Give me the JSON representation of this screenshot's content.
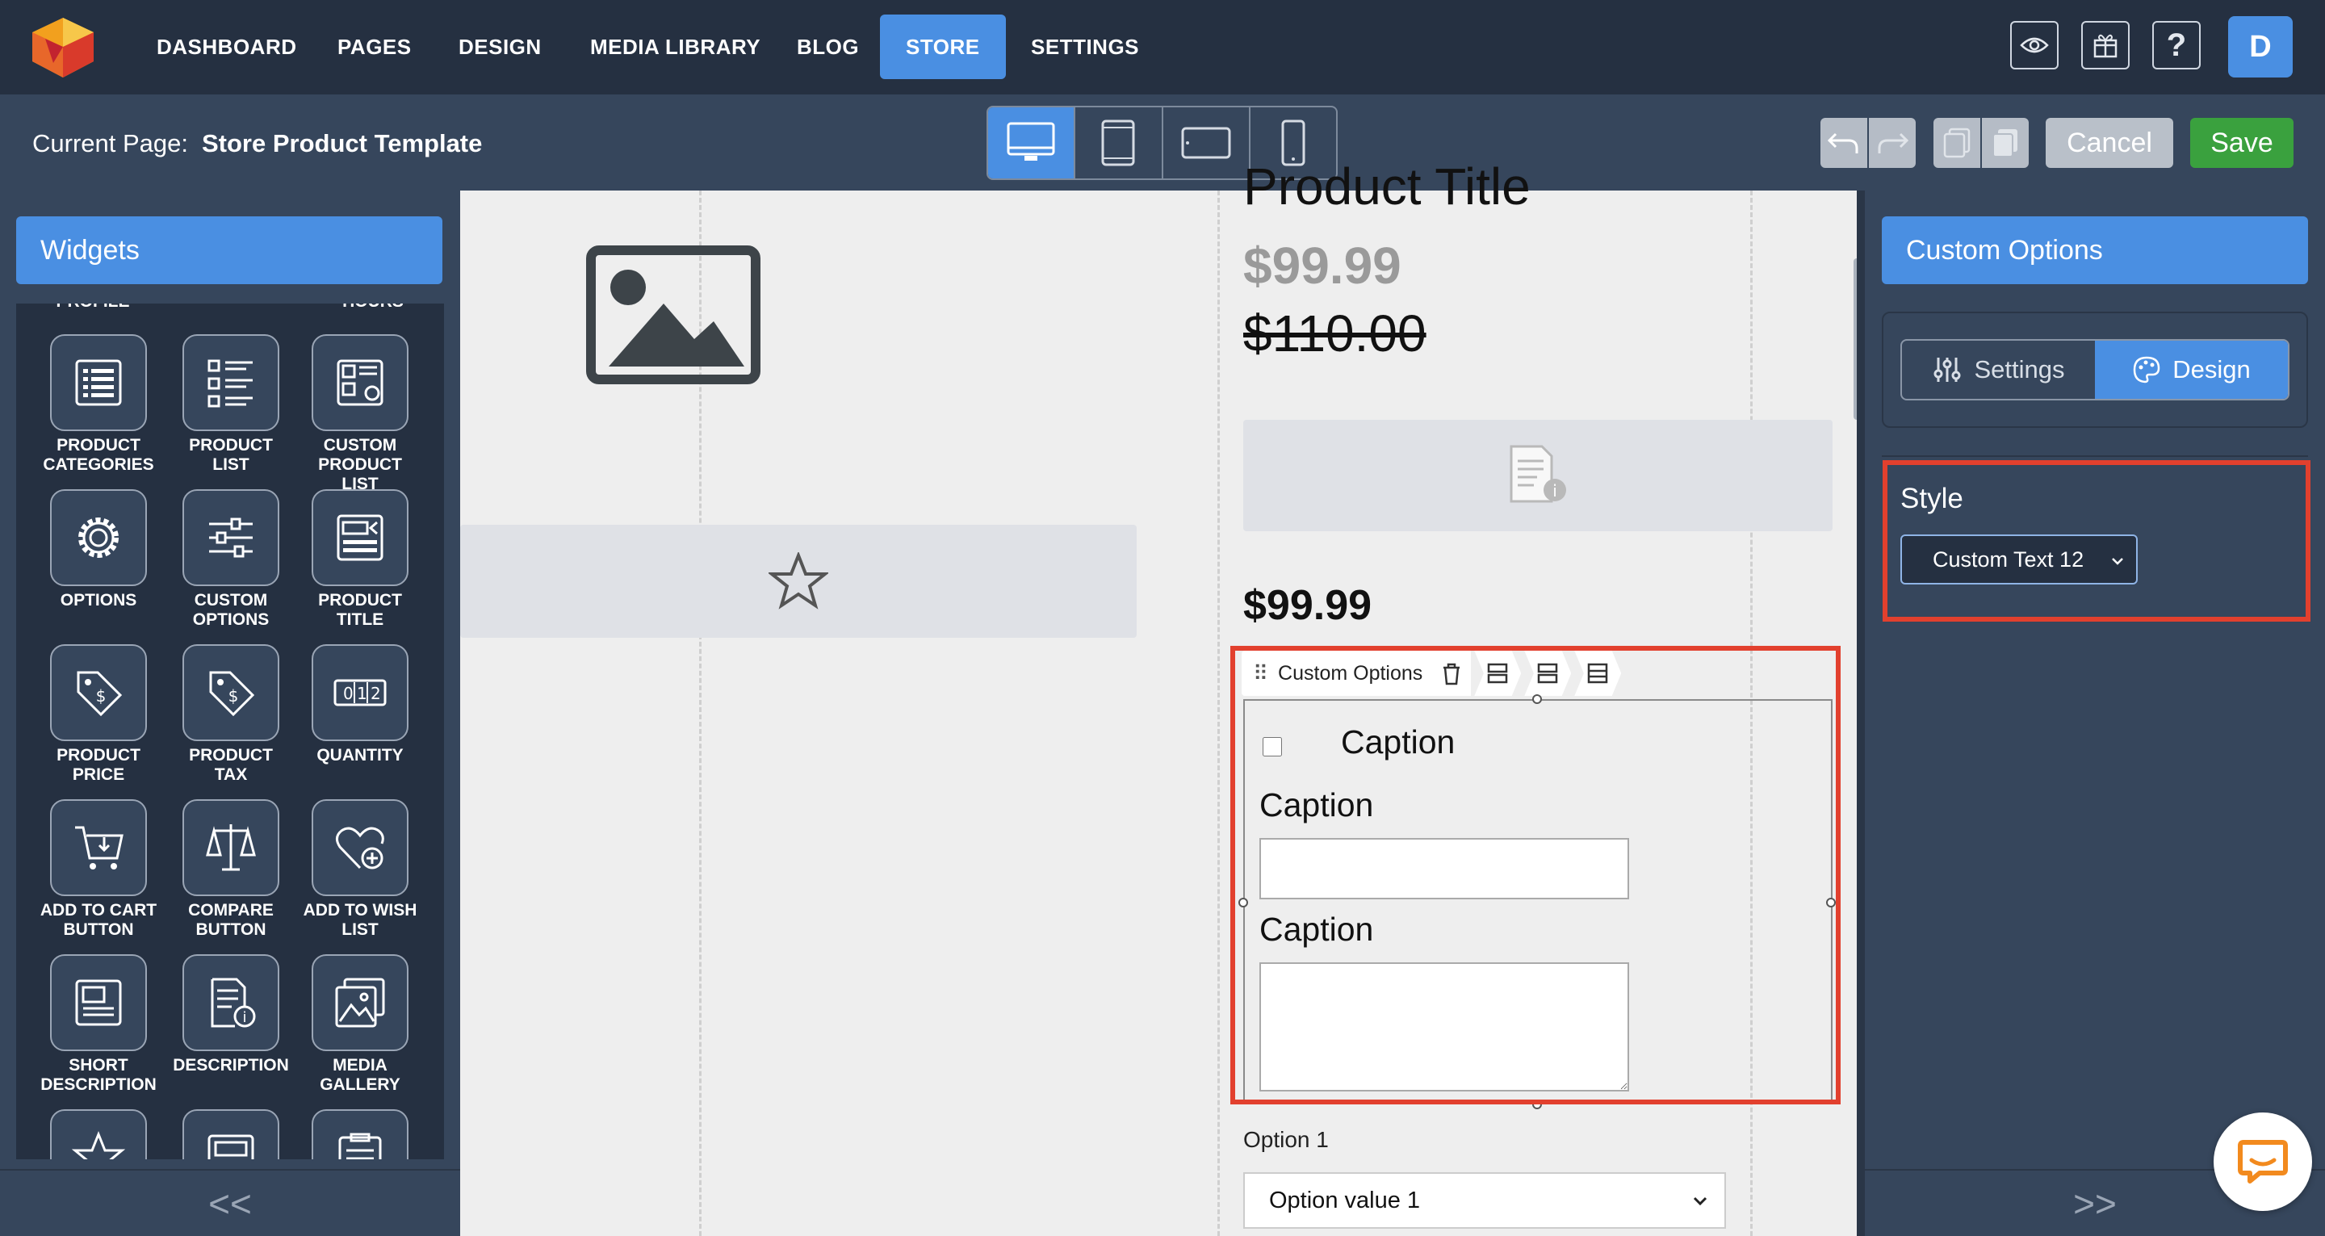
{
  "nav": {
    "items": [
      {
        "label": "DASHBOARD"
      },
      {
        "label": "PAGES"
      },
      {
        "label": "DESIGN"
      },
      {
        "label": "MEDIA LIBRARY"
      },
      {
        "label": "BLOG"
      },
      {
        "label": "STORE",
        "active": true
      },
      {
        "label": "SETTINGS"
      }
    ],
    "user_initial": "D",
    "icons": [
      "eye-icon",
      "add-gift-icon",
      "help-icon"
    ]
  },
  "subbar": {
    "current_page_label": "Current Page:",
    "current_page_name": "Store Product Template",
    "devices": [
      "desktop",
      "tablet-portrait",
      "tablet-landscape",
      "phone"
    ],
    "active_device": "desktop",
    "cancel_label": "Cancel",
    "save_label": "Save"
  },
  "left_panel": {
    "title": "Widgets",
    "partial_top_labels": [
      "PROFILE",
      "HOURS"
    ],
    "widgets": [
      {
        "label": "PRODUCT CATEGORIES",
        "icon": "list-icon"
      },
      {
        "label": "PRODUCT LIST",
        "icon": "bullet-list-icon"
      },
      {
        "label": "CUSTOM PRODUCT LIST",
        "icon": "grid-gear-icon"
      },
      {
        "label": "OPTIONS",
        "icon": "gear-icon"
      },
      {
        "label": "CUSTOM OPTIONS",
        "icon": "sliders-icon"
      },
      {
        "label": "PRODUCT TITLE",
        "icon": "title-icon"
      },
      {
        "label": "PRODUCT PRICE",
        "icon": "price-tag-icon"
      },
      {
        "label": "PRODUCT TAX",
        "icon": "tax-tag-icon"
      },
      {
        "label": "QUANTITY",
        "icon": "quantity-icon"
      },
      {
        "label": "ADD TO CART BUTTON",
        "icon": "cart-icon"
      },
      {
        "label": "COMPARE BUTTON",
        "icon": "scale-icon"
      },
      {
        "label": "ADD TO WISH LIST",
        "icon": "heart-plus-icon"
      },
      {
        "label": "SHORT DESCRIPTION",
        "icon": "short-doc-icon"
      },
      {
        "label": "DESCRIPTION",
        "icon": "doc-info-icon"
      },
      {
        "label": "MEDIA GALLERY",
        "icon": "gallery-icon"
      }
    ],
    "footer": "<<"
  },
  "canvas": {
    "product_title": "Product Title",
    "sale_price": "$99.99",
    "old_price": "$110.00",
    "price": "$99.99",
    "toolbar_label": "Custom Options",
    "checkbox_caption": "Caption",
    "input_caption": "Caption",
    "textarea_caption": "Caption",
    "option_label": "Option 1",
    "option_value": "Option value 1"
  },
  "right_panel": {
    "title": "Custom Options",
    "tabs": [
      {
        "label": "Settings",
        "icon": "sliders-icon"
      },
      {
        "label": "Design",
        "icon": "palette-icon",
        "active": true
      }
    ],
    "style_label": "Style",
    "style_value": "Custom Text 12",
    "footer": ">>"
  },
  "colors": {
    "nav_bg": "#253041",
    "subbar_bg": "#36465c",
    "accent": "#4a8fe2",
    "save": "#3aa13e",
    "highlight": "#e2402e"
  }
}
